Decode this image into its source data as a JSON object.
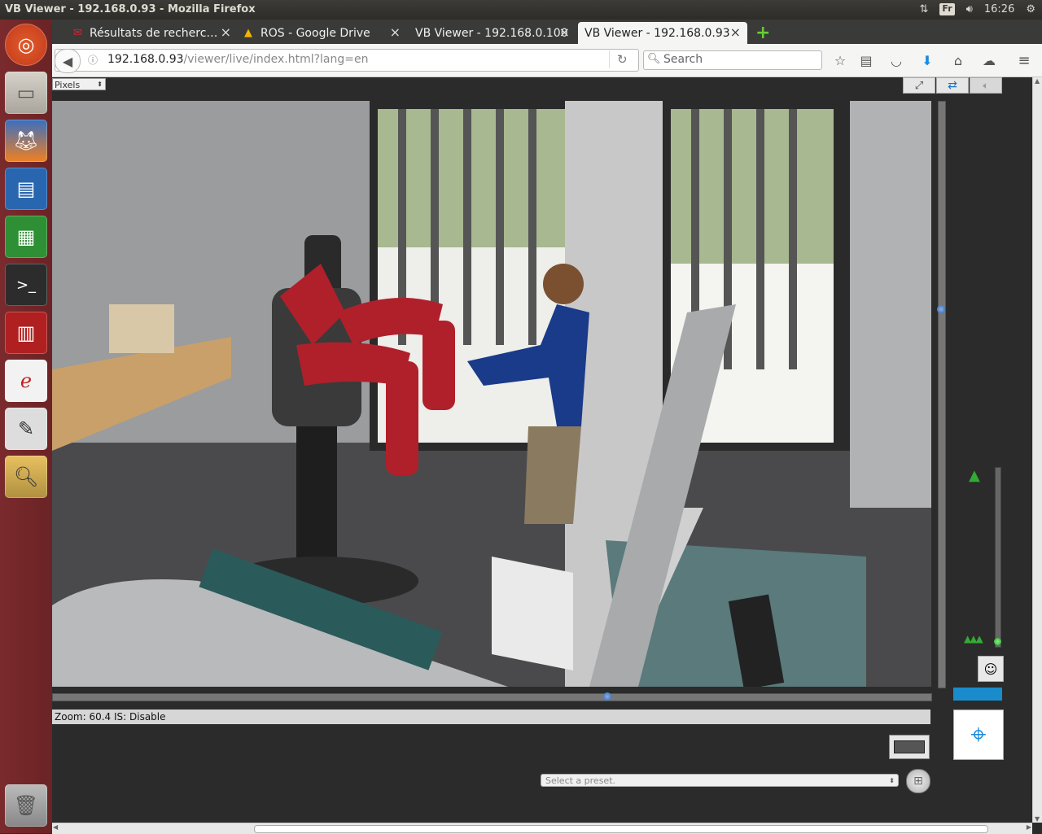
{
  "window": {
    "title": "VB Viewer - 192.168.0.93 - Mozilla Firefox"
  },
  "tray": {
    "keyboard": "Fr",
    "time": "16:26"
  },
  "tabs": [
    {
      "label": "Résultats de recherc…"
    },
    {
      "label": "ROS - Google Drive"
    },
    {
      "label": "VB Viewer - 192.168.0.100"
    },
    {
      "label": "VB Viewer - 192.168.0.93"
    }
  ],
  "address": {
    "host": "192.168.0.93",
    "path": "/viewer/live/index.html?lang=en"
  },
  "search": {
    "placeholder": "Search"
  },
  "viewer": {
    "units_select": "Pixels",
    "status": "Zoom: 60.4 IS: Disable",
    "preset_placeholder": "Select a preset."
  }
}
